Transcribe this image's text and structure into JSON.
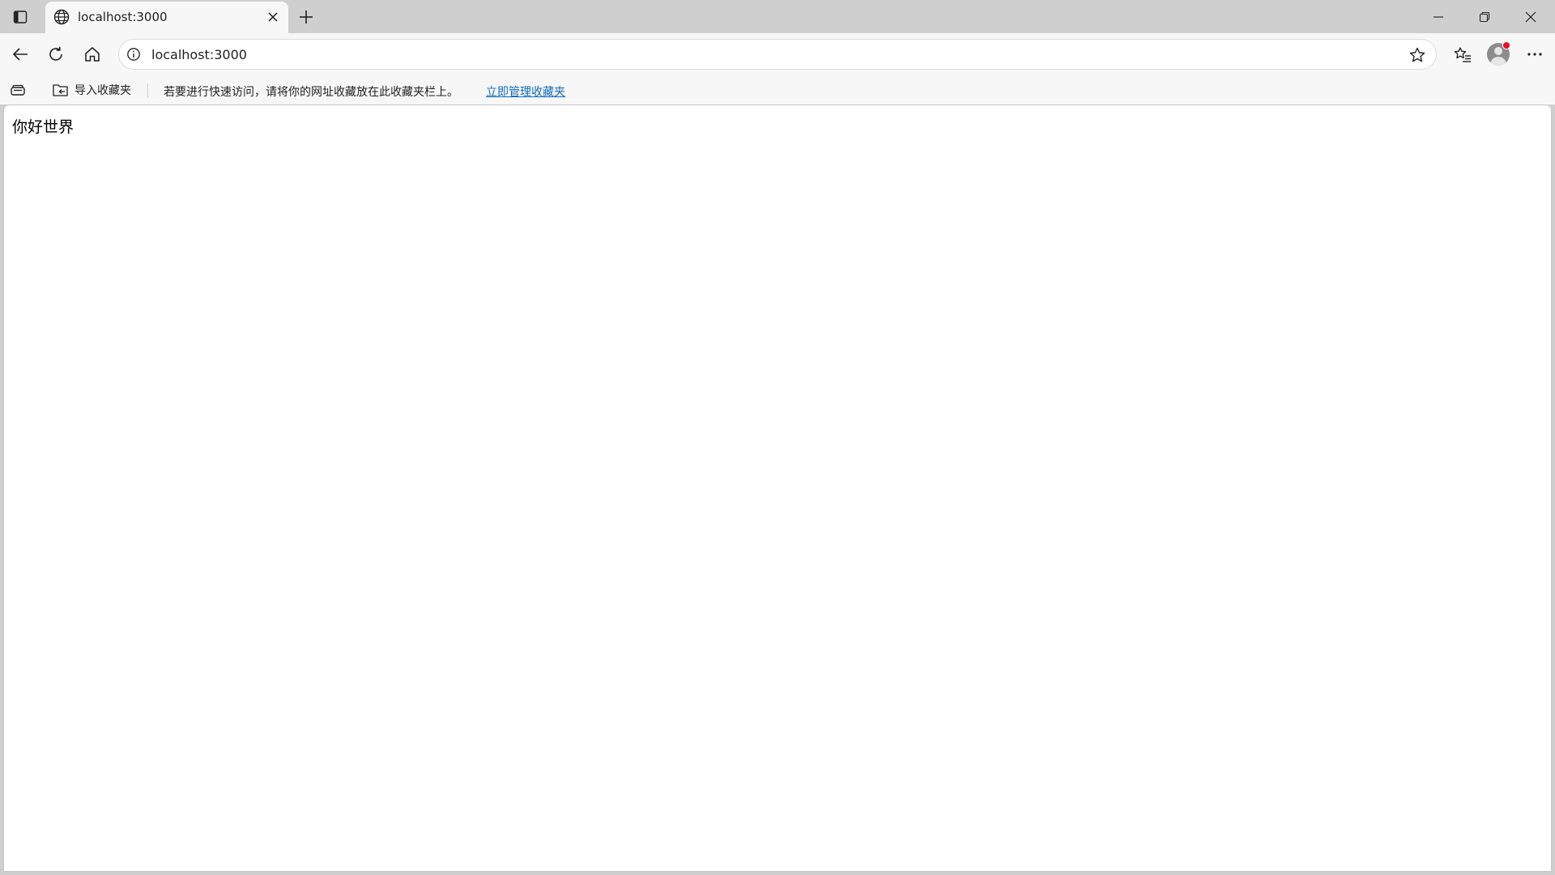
{
  "tab": {
    "title": "localhost:3000"
  },
  "address_bar": {
    "url": "localhost:3000"
  },
  "favorites_bar": {
    "import_label": "导入收藏夹",
    "hint": "若要进行快速访问，请将你的网址收藏放在此收藏夹栏上。",
    "manage_link": "立即管理收藏夹"
  },
  "page": {
    "text": "你好世界"
  },
  "colors": {
    "link": "#0f6cbd",
    "notification_dot": "#e81123"
  },
  "icons": {
    "tab_actions": "tab-actions-icon",
    "favicon": "globe-icon",
    "close": "close-icon",
    "new_tab": "plus-icon",
    "minimize": "minimize-icon",
    "restore": "restore-icon",
    "back": "back-arrow-icon",
    "reload": "reload-icon",
    "home": "home-icon",
    "site_info": "info-icon",
    "favorite": "star-icon",
    "favorites": "favorites-icon",
    "profile": "avatar",
    "more": "more-icon",
    "collections": "collections-icon",
    "import": "import-folder-icon"
  }
}
